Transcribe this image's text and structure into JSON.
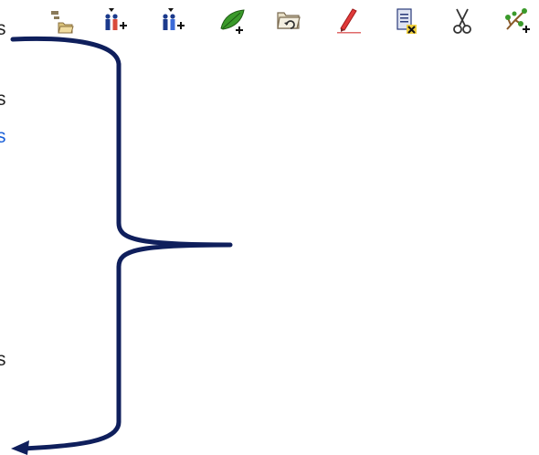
{
  "left_clipped_text": [
    "s",
    "s",
    "s",
    "s"
  ],
  "toolbar": {
    "buttons": [
      {
        "name": "new-folders-icon"
      },
      {
        "name": "add-person-icon"
      },
      {
        "name": "add-person-alt-icon"
      },
      {
        "name": "add-leaf-icon"
      },
      {
        "name": "open-folder-undo-icon"
      },
      {
        "name": "edit-pencil-icon"
      },
      {
        "name": "delete-document-icon"
      },
      {
        "name": "scissors-icon"
      },
      {
        "name": "add-branch-icon"
      }
    ]
  },
  "colors": {
    "brace": "#0f1f5c",
    "link_text": "#1a5fd8",
    "dark_text": "#222222",
    "pencil": "#e03a3a",
    "leaf": "#3a9a2a",
    "folder": "#d9c27a"
  }
}
